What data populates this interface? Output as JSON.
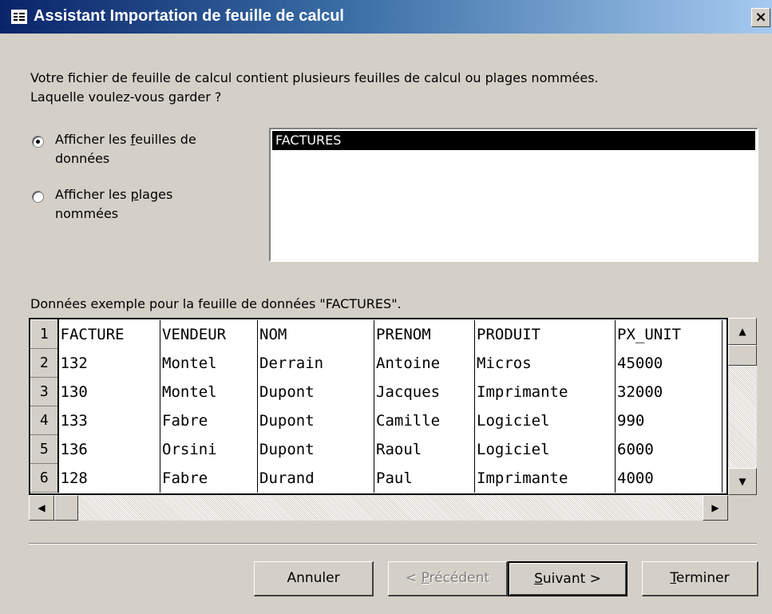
{
  "window": {
    "title": "Assistant Importation de feuille de calcul",
    "close_label": "×"
  },
  "intro": {
    "line1": "Votre fichier de feuille de calcul contient plusieurs feuilles de calcul ou plages nommées.",
    "line2": "Laquelle voulez-vous garder ?"
  },
  "options": [
    {
      "label_prefix": "Afficher les ",
      "label_access": "f",
      "label_suffix": "euilles de",
      "label_line2": "données",
      "checked": true
    },
    {
      "label_prefix": "Afficher les ",
      "label_access": "p",
      "label_suffix": "lages",
      "label_line2": "nommées",
      "checked": false
    }
  ],
  "sheets": [
    "FACTURES"
  ],
  "sample_label": "Données exemple pour la feuille de données \"FACTURES\".",
  "grid": {
    "rows": [
      {
        "num": "1",
        "cells": [
          "FACTURE",
          "VENDEUR",
          "NOM",
          "PRENOM",
          "PRODUIT",
          "PX_UNIT"
        ]
      },
      {
        "num": "2",
        "cells": [
          "132",
          "Montel",
          "Derrain",
          "Antoine",
          "Micros",
          "45000"
        ]
      },
      {
        "num": "3",
        "cells": [
          "130",
          "Montel",
          "Dupont",
          "Jacques",
          "Imprimante",
          "32000"
        ]
      },
      {
        "num": "4",
        "cells": [
          "133",
          "Fabre",
          "Dupont",
          "Camille",
          "Logiciel",
          "990"
        ]
      },
      {
        "num": "5",
        "cells": [
          "136",
          "Orsini",
          "Dupont",
          "Raoul",
          "Logiciel",
          "6000"
        ]
      },
      {
        "num": "6",
        "cells": [
          "128",
          "Fabre",
          "Durand",
          "Paul",
          "Imprimante",
          "4000"
        ]
      }
    ]
  },
  "buttons": {
    "cancel": "Annuler",
    "prev": {
      "prefix": "< ",
      "access": "P",
      "suffix": "récédent"
    },
    "next": {
      "prefix": "",
      "access": "S",
      "suffix": "uivant >"
    },
    "finish": {
      "prefix": "",
      "access": "T",
      "suffix": "erminer"
    }
  },
  "icons": {
    "scroll_up": "▲",
    "scroll_down": "▼",
    "scroll_left": "◀",
    "scroll_right": "▶"
  }
}
